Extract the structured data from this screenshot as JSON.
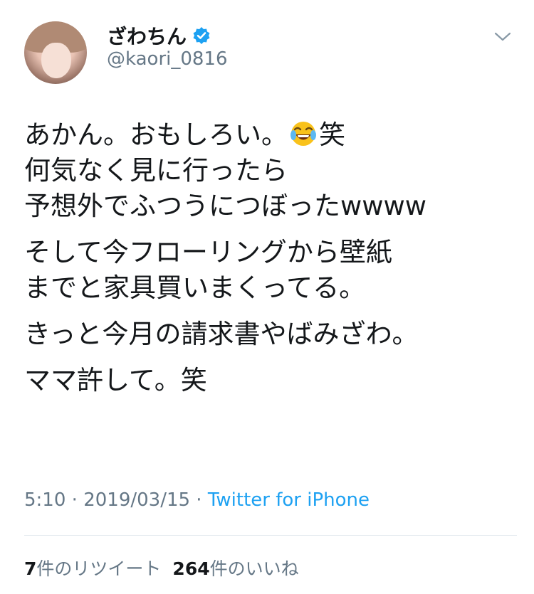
{
  "user": {
    "display_name": "ざわちん",
    "handle": "@kaori_0816",
    "verified": true,
    "avatar": "profile-photo"
  },
  "tweet": {
    "paragraphs": [
      [
        "あかん。おもしろい。",
        "笑",
        "何気なく見に行ったら",
        "予想外でふつうにつぼったwwww"
      ],
      [
        "そして今フローリングから壁紙",
        "までと家具買いまくってる。"
      ],
      [
        "きっと今月の請求書やばみざわ。"
      ],
      [
        "ママ許して。笑"
      ]
    ],
    "emoji": "face-with-tears-of-joy-icon"
  },
  "meta": {
    "time": "5:10",
    "sep1": " · ",
    "date": "2019/03/15",
    "sep2": " · ",
    "source": "Twitter for iPhone"
  },
  "stats": {
    "retweets_count": "7",
    "retweets_label": "件のリツイート",
    "likes_count": "264",
    "likes_label": "件のいいね"
  },
  "colors": {
    "text": "#14171a",
    "secondary": "#657786",
    "link": "#1da1f2",
    "verified": "#1da1f2",
    "divider": "#e1e8ed"
  }
}
